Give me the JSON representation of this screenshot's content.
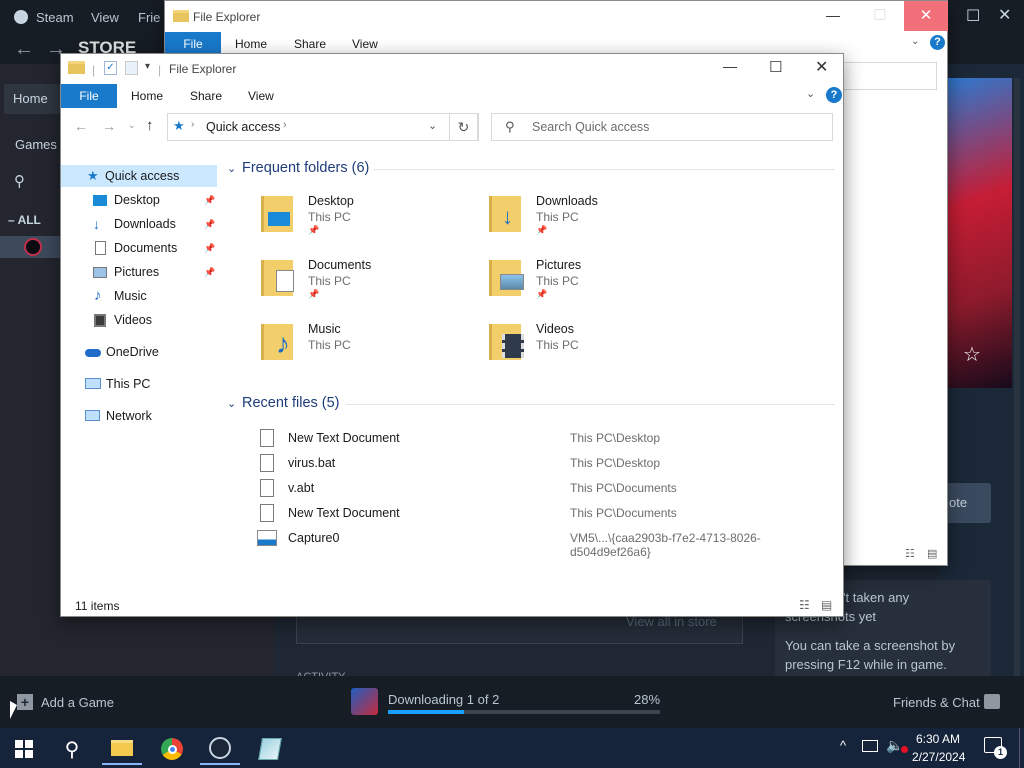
{
  "steam": {
    "menu": [
      "Steam",
      "View",
      "Frie"
    ],
    "store": "STORE",
    "home": "Home",
    "games": "Games",
    "all": "ALL",
    "add_game": "Add a Game",
    "downloading": "Downloading 1 of 2",
    "percent": "28%",
    "progress": 0.28,
    "friends": "Friends & Chat",
    "view_all": "View all in store",
    "no_shots1": "'t taken any",
    "no_shots2": "screenshots yet",
    "shot_hint1": "You can take a screenshot by",
    "shot_hint2": "pressing F12 while in game.",
    "note": "ote",
    "activity": "ACTIVITY"
  },
  "back_explorer": {
    "title": "File Explorer",
    "tabs": [
      "File",
      "Home",
      "Share",
      "View"
    ]
  },
  "explorer": {
    "title": "File Explorer",
    "tabs": {
      "file": "File",
      "home": "Home",
      "share": "Share",
      "view": "View"
    },
    "address": "Quick access",
    "search_placeholder": "Search Quick access",
    "sidebar": [
      {
        "label": "Quick access",
        "icon": "star-icon"
      },
      {
        "label": "Desktop",
        "icon": "desktop-icon"
      },
      {
        "label": "Downloads",
        "icon": "download-icon"
      },
      {
        "label": "Documents",
        "icon": "documents-icon"
      },
      {
        "label": "Pictures",
        "icon": "pictures-icon"
      },
      {
        "label": "Music",
        "icon": "music-icon"
      },
      {
        "label": "Videos",
        "icon": "videos-icon"
      },
      {
        "label": "OneDrive",
        "icon": "cloud-icon"
      },
      {
        "label": "This PC",
        "icon": "pc-icon"
      },
      {
        "label": "Network",
        "icon": "network-icon"
      }
    ],
    "frequent_header": "Frequent folders (6)",
    "folders": [
      {
        "name": "Desktop",
        "sub": "This PC"
      },
      {
        "name": "Downloads",
        "sub": "This PC"
      },
      {
        "name": "Documents",
        "sub": "This PC"
      },
      {
        "name": "Pictures",
        "sub": "This PC"
      },
      {
        "name": "Music",
        "sub": "This PC"
      },
      {
        "name": "Videos",
        "sub": "This PC"
      }
    ],
    "recent_header": "Recent files (5)",
    "recent": [
      {
        "name": "New Text Document",
        "path": "This PC\\Desktop"
      },
      {
        "name": "virus.bat",
        "path": "This PC\\Desktop"
      },
      {
        "name": "v.abt",
        "path": "This PC\\Documents"
      },
      {
        "name": "New Text Document",
        "path": "This PC\\Documents"
      },
      {
        "name": "Capture0",
        "path": "VM5\\...\\{caa2903b-f7e2-4713-8026-d504d9ef26a6}"
      }
    ],
    "status": "11 items"
  },
  "taskbar": {
    "time": "6:30 AM",
    "date": "2/27/2024",
    "notifications": "1"
  }
}
